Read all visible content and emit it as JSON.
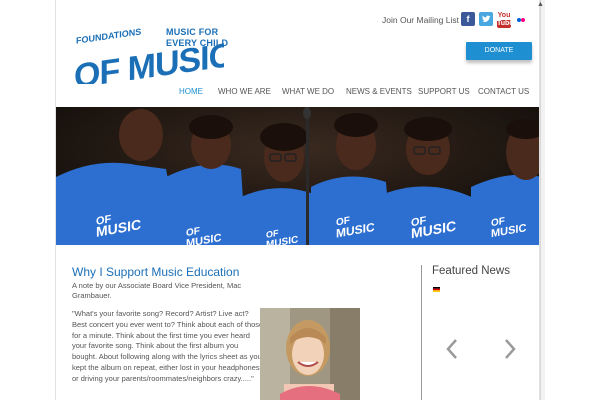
{
  "header": {
    "logo_text": "OF MUSIC",
    "logo_arc": "FOUNDATIONS",
    "tagline_line1": "MUSIC FOR",
    "tagline_line2": "EVERY CHILD",
    "mailing_list": "Join Our Mailing List",
    "donate_label": "DONATE",
    "social": {
      "facebook": "f",
      "youtube_line1": "You",
      "youtube_line2": "Tube"
    },
    "colors": {
      "brand_blue": "#1b6fb6",
      "donate_blue": "#1e8fd0"
    }
  },
  "nav": {
    "items": [
      {
        "label": "HOME"
      },
      {
        "label": "WHO WE ARE"
      },
      {
        "label": "WHAT WE DO"
      },
      {
        "label": "NEWS & EVENTS"
      },
      {
        "label": "SUPPORT US"
      },
      {
        "label": "CONTACT US"
      }
    ]
  },
  "hero": {
    "shirt_text_line1": "OF",
    "shirt_text_line2": "MUSIC"
  },
  "article": {
    "title": "Why I Support Music Education",
    "subnote": "A note by our Associate Board Vice President, Mac Grambauer.",
    "quote": "\"What's your favorite song? Record? Artist? Live act? Best concert you ever went to? Think about each of those for a minute. Think about the first time you ever heard your favorite song. Think about the first album you bought. About following along with the lyrics sheet as you kept the album on repeat, either lost in your headphones or driving your parents/roommates/neighbors crazy.....\""
  },
  "sidebar": {
    "featured_title": "Featured News"
  }
}
